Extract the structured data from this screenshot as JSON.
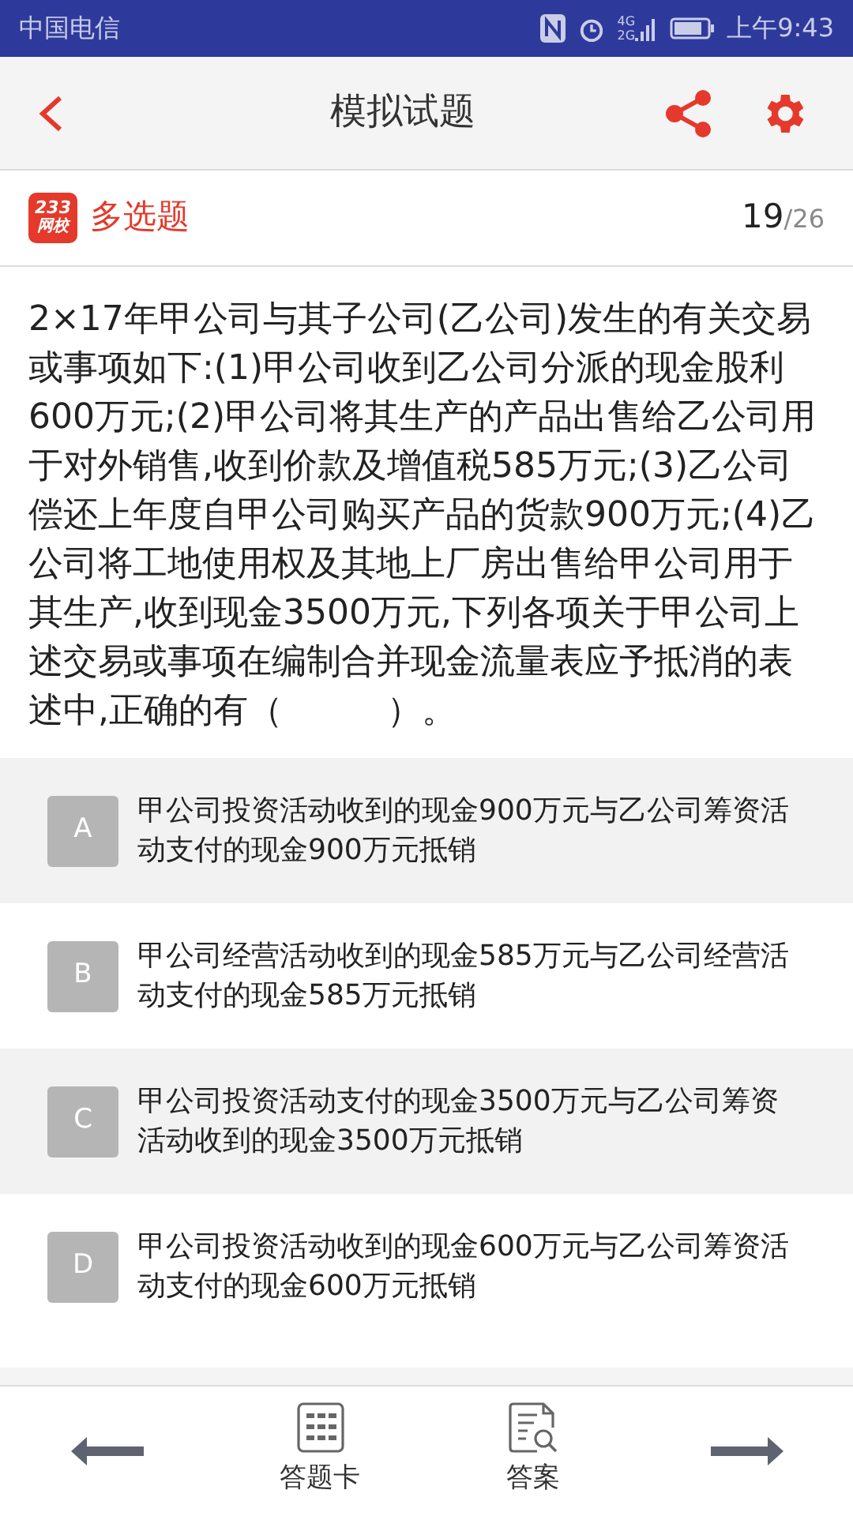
{
  "status_bar": {
    "carrier": "中国电信",
    "network_labels": [
      "4G",
      "2G"
    ],
    "time": "上午9:43"
  },
  "header": {
    "title": "模拟试题"
  },
  "question_bar": {
    "logo_lines": [
      "233",
      "网校"
    ],
    "type": "多选题",
    "current": "19",
    "total": "/26"
  },
  "question": {
    "text": "2×17年甲公司与其子公司(乙公司)发生的有关交易或事项如下:(1)甲公司收到乙公司分派的现金股利600万元;(2)甲公司将其生产的产品出售给乙公司用于对外销售,收到价款及增值税585万元;(3)乙公司偿还上年度自甲公司购买产品的货款900万元;(4)乙公司将工地使用权及其地上厂房出售给甲公司用于其生产,收到现金3500万元,下列各项关于甲公司上述交易或事项在编制合并现金流量表应予抵消的表述中,正确的有（　　　）。"
  },
  "options": [
    {
      "letter": "A",
      "text": "甲公司投资活动收到的现金900万元与乙公司筹资活动支付的现金900万元抵销",
      "selected": false
    },
    {
      "letter": "B",
      "text": "甲公司经营活动收到的现金585万元与乙公司经营活动支付的现金585万元抵销",
      "selected": false
    },
    {
      "letter": "C",
      "text": "甲公司投资活动支付的现金3500万元与乙公司筹资活动收到的现金3500万元抵销",
      "selected": false
    },
    {
      "letter": "D",
      "text": "甲公司投资活动收到的现金600万元与乙公司筹资活动支付的现金600万元抵销",
      "selected": false
    }
  ],
  "bottom_bar": {
    "items": [
      {
        "kind": "prev"
      },
      {
        "kind": "card",
        "label": "答题卡"
      },
      {
        "kind": "answer",
        "label": "答案"
      },
      {
        "kind": "next"
      }
    ]
  }
}
